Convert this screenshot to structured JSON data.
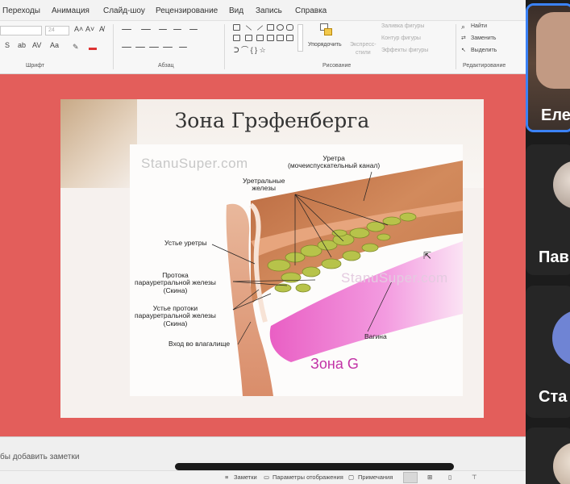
{
  "menu": {
    "items": [
      "Переходы",
      "Анимация",
      "Слайд-шоу",
      "Рецензирование",
      "Вид",
      "Запись",
      "Справка"
    ]
  },
  "ribbon": {
    "groups": {
      "font": "Шрифт",
      "paragraph": "Абзац",
      "drawing": "Рисование",
      "editing": "Редактирование"
    },
    "font_size": "24",
    "arrange": "Упорядочить",
    "quick_styles": [
      "Экспресс-",
      "стили"
    ],
    "shape_fill": "Заливка фигуры",
    "shape_outline": "Контур фигуры",
    "shape_effects": "Эффекты фигуры",
    "find": "Найти",
    "replace": "Заменить",
    "select": "Выделить"
  },
  "slide": {
    "title": "Зона Грэфенберга",
    "watermark_1": "StanuSuper.com",
    "watermark_2": "StanuSuper.com",
    "labels": {
      "urethra": [
        "Уретра",
        "(мочеиспускательный канал)"
      ],
      "urethral_glands": [
        "Уретральные",
        "железы"
      ],
      "urethra_opening": "Устье уретры",
      "ducts": [
        "Протока",
        "парауретральной железы",
        "(Скина)"
      ],
      "duct_openings": [
        "Устье протоки",
        "парауретральной железы",
        "(Скина)"
      ],
      "vaginal_entrance": "Вход во влагалище",
      "vagina": "Вагина",
      "zone_g": "Зона G"
    }
  },
  "notes": {
    "placeholder": "бы добавить заметки"
  },
  "statusbar": {
    "notes": "Заметки",
    "display_settings": "Параметры отображения",
    "comments": "Примечания"
  },
  "participants": [
    {
      "name": "Еле",
      "active": true
    },
    {
      "name": "Пав",
      "active": false
    },
    {
      "name": "Ста",
      "active": false
    },
    {
      "name": "",
      "active": false
    }
  ],
  "colors": {
    "stage": "#e35e5b",
    "active_speaker_border": "#3b82f6",
    "zone_g": "#c232a6"
  }
}
